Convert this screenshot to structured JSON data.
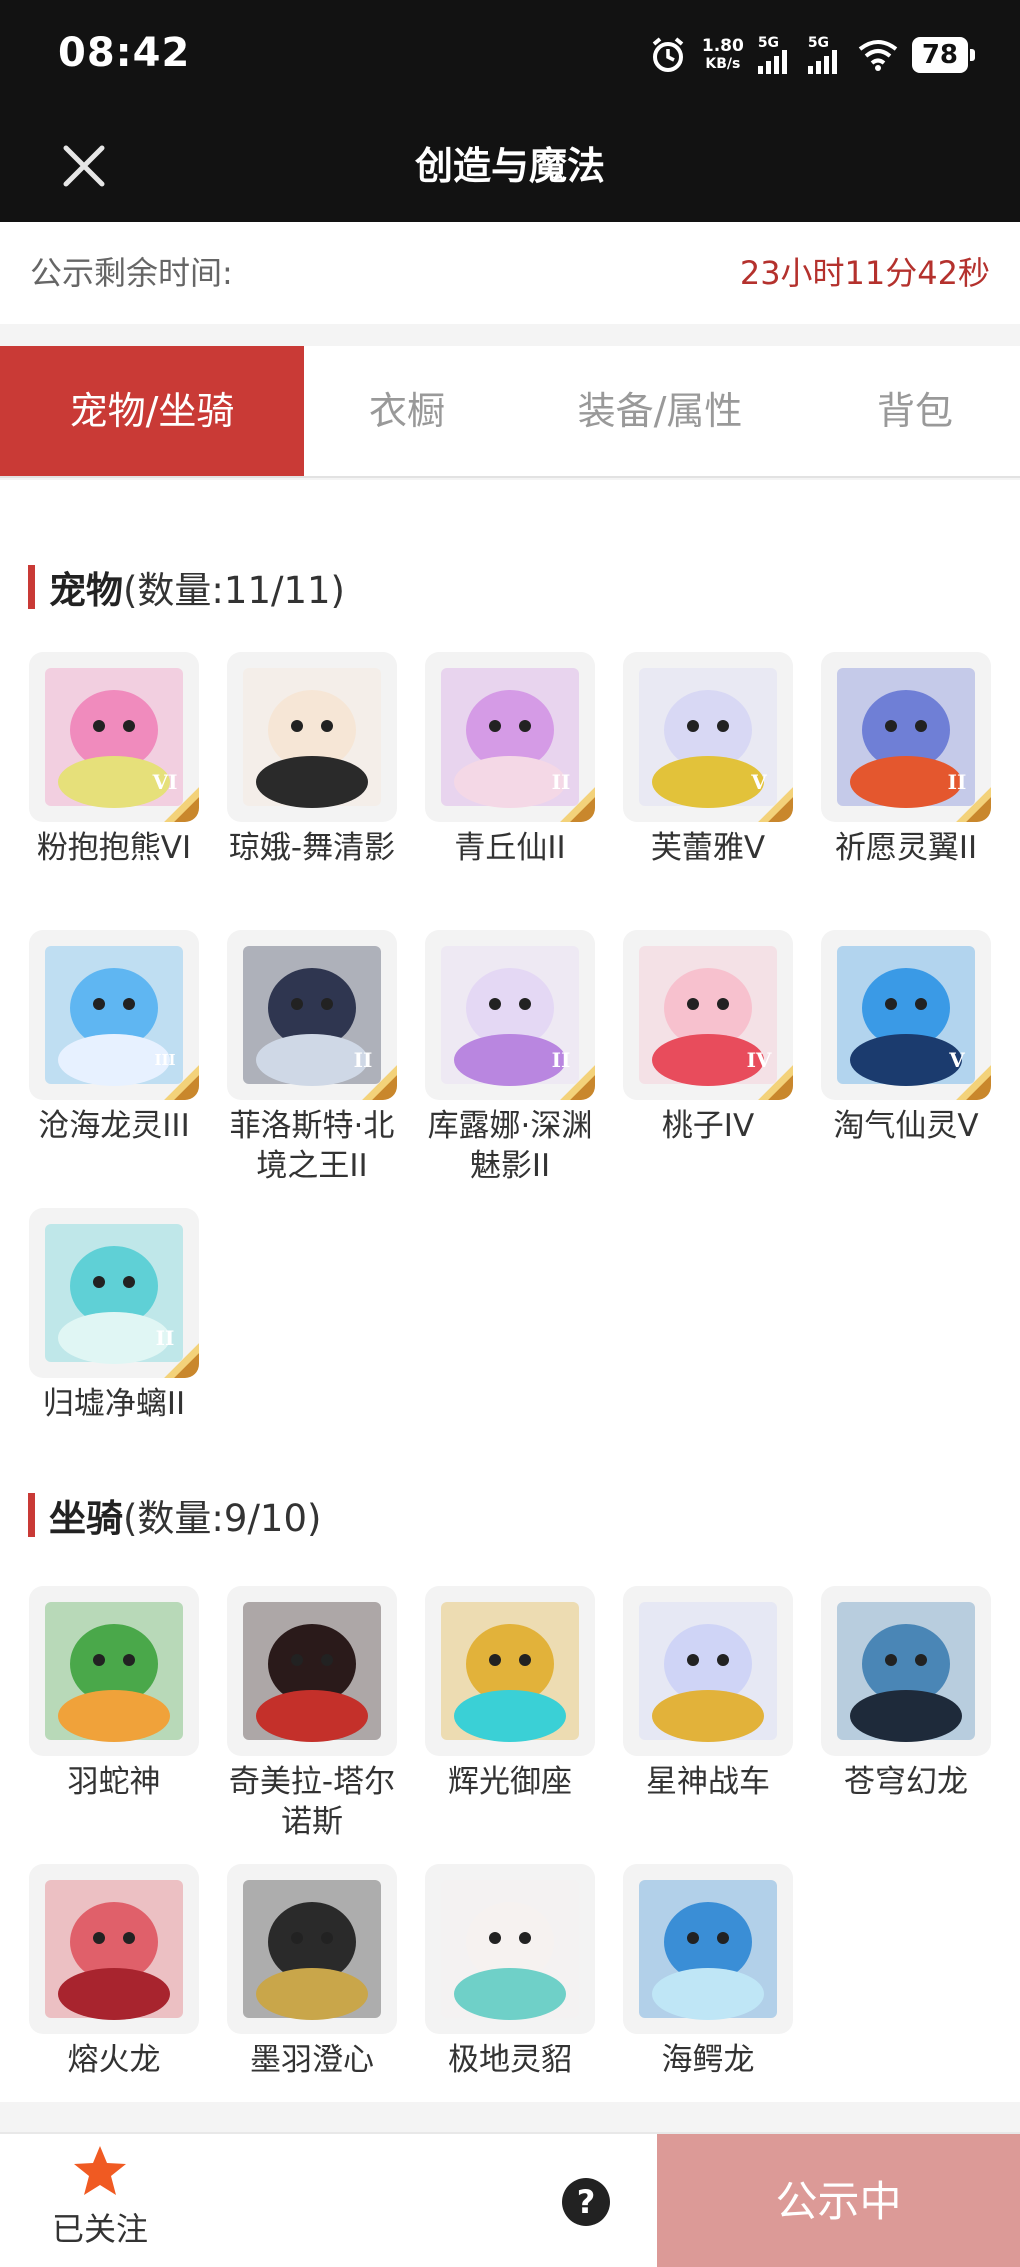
{
  "status_bar": {
    "time": "08:42",
    "net_speed": "1.80",
    "net_unit": "KB/s",
    "sim1": "5G",
    "sim2": "5G",
    "battery": "78"
  },
  "header": {
    "title": "创造与魔法"
  },
  "notice": {
    "label": "公示剩余时间:",
    "value": "23小时11分42秒"
  },
  "tabs": [
    {
      "label": "宠物/坐骑",
      "active": true
    },
    {
      "label": "衣橱"
    },
    {
      "label": "装备/属性"
    },
    {
      "label": "背包"
    }
  ],
  "pets": {
    "title": "宠物",
    "count": "(数量:11/11)",
    "items": [
      {
        "name": "粉抱抱熊VI",
        "rank": "VI",
        "colors": [
          "#f08bbd",
          "#e6e07a"
        ]
      },
      {
        "name": "琼娥-舞清影",
        "rank": "",
        "colors": [
          "#f6e6d6",
          "#2a2a2a"
        ]
      },
      {
        "name": "青丘仙II",
        "rank": "II",
        "colors": [
          "#d59be6",
          "#f4d8e6"
        ]
      },
      {
        "name": "芙蕾雅V",
        "rank": "V",
        "colors": [
          "#d8d8f4",
          "#e2c23a"
        ]
      },
      {
        "name": "祈愿灵翼II",
        "rank": "II",
        "colors": [
          "#6f7fd6",
          "#e4572e"
        ]
      },
      {
        "name": "沧海龙灵III",
        "rank": "III",
        "colors": [
          "#5fb6f2",
          "#e7f1ff"
        ]
      },
      {
        "name": "菲洛斯特·北境之王II",
        "rank": "II",
        "colors": [
          "#2f3650",
          "#cfd8e6"
        ]
      },
      {
        "name": "库露娜·深渊魅影II",
        "rank": "II",
        "colors": [
          "#e4d8f4",
          "#b986e0"
        ]
      },
      {
        "name": "桃子IV",
        "rank": "IV",
        "colors": [
          "#f7c1ce",
          "#e84c5c"
        ]
      },
      {
        "name": "淘气仙灵V",
        "rank": "V",
        "colors": [
          "#3a9ae6",
          "#1b3b6e"
        ]
      },
      {
        "name": "归墟净螭II",
        "rank": "II",
        "colors": [
          "#5fd0d6",
          "#e0f6f4"
        ]
      }
    ]
  },
  "mounts": {
    "title": "坐骑",
    "count": "(数量:9/10)",
    "items": [
      {
        "name": "羽蛇神",
        "rank": "",
        "colors": [
          "#4aa84a",
          "#f0a23a"
        ]
      },
      {
        "name": "奇美拉-塔尔诺斯",
        "rank": "",
        "colors": [
          "#2a1a1a",
          "#c4302a"
        ]
      },
      {
        "name": "辉光御座",
        "rank": "",
        "colors": [
          "#e2b23a",
          "#3ad0d6"
        ]
      },
      {
        "name": "星神战车",
        "rank": "",
        "colors": [
          "#cfd4f6",
          "#e2b23a"
        ]
      },
      {
        "name": "苍穹幻龙",
        "rank": "",
        "colors": [
          "#4a86b6",
          "#1e2a3a"
        ]
      },
      {
        "name": "熔火龙",
        "rank": "",
        "colors": [
          "#e0606a",
          "#a8242e"
        ]
      },
      {
        "name": "墨羽澄心",
        "rank": "",
        "colors": [
          "#2a2a2a",
          "#c9a64a"
        ]
      },
      {
        "name": "极地灵貂",
        "rank": "",
        "colors": [
          "#f6f2f0",
          "#6fd0c8"
        ]
      },
      {
        "name": "海鳄龙",
        "rank": "",
        "colors": [
          "#3a8ed6",
          "#bfe6f6"
        ]
      }
    ]
  },
  "footer": {
    "follow_label": "已关注",
    "help": "?",
    "status_label": "公示中"
  }
}
